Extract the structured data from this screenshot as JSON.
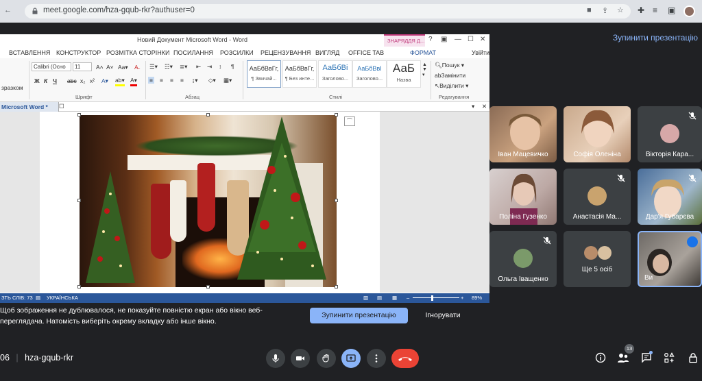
{
  "browser": {
    "url": "meet.google.com/hza-gqub-rkr?authuser=0"
  },
  "meet": {
    "stop_presenting_link": "Зупинити презентацію",
    "meeting_code": "hza-gqub-rkr",
    "time_fragment": "06",
    "participants_count": "13",
    "tiles": [
      {
        "name": "Іван Мацевичко",
        "muted": false
      },
      {
        "name": "Софія Оленіна",
        "muted": false
      },
      {
        "name": "Вікторія Кара...",
        "muted": true
      },
      {
        "name": "Поліна Гузенко",
        "muted": false
      },
      {
        "name": "Анастасія Ма...",
        "muted": true
      },
      {
        "name": "Дар'я Губарєва",
        "muted": true
      },
      {
        "name": "Ольга Іващенко",
        "muted": true
      },
      {
        "name": "Ще 5 осіб",
        "muted": false
      },
      {
        "name": "Ви",
        "muted": false
      }
    ],
    "warning_line1": "Щоб зображення не дублювалося, не показуйте повністю екран або вікно веб-",
    "warning_line2": "переглядача. Натомість виберіть окрему вкладку або інше вікно.",
    "stop_button": "Зупинити презентацію",
    "ignore_button": "Ігнорувати"
  },
  "word": {
    "title": "Новий Документ Microsoft Word - Word",
    "context_tab": "ЗНАРЯДДЯ Д...",
    "format_tab": "ФОРМАТ",
    "sign_in": "Увійти",
    "tabs": [
      "ВСТАВЛЕННЯ",
      "КОНСТРУКТОР",
      "РОЗМІТКА СТОРІНКИ",
      "ПОСИЛАННЯ",
      "РОЗСИЛКИ",
      "РЕЦЕНЗУВАННЯ",
      "ВИГЛЯД",
      "OFFICE TAB"
    ],
    "clipboard_label": "зразком",
    "font_name": "Calibri (Осно",
    "font_size": "11",
    "bold": "Ж",
    "italic": "К",
    "underline": "Ч",
    "strike": "abc",
    "subscript": "x₂",
    "superscript": "x²",
    "group_font": "Шрифт",
    "group_paragraph": "Абзац",
    "group_styles": "Стилі",
    "group_editing": "Редагування",
    "styles": [
      {
        "preview": "АаБбВвГг,",
        "name": "¶ Звичай..."
      },
      {
        "preview": "АаБбВвГг,",
        "name": "¶ Без инте..."
      },
      {
        "preview": "АаБбВі",
        "name": "Заголово..."
      },
      {
        "preview": "АаБбВвІ",
        "name": "Заголово..."
      },
      {
        "preview": "АаБ",
        "name": "Назва"
      }
    ],
    "find": "Пошук",
    "replace": "Замінити",
    "select": "Виділити",
    "doc_tab": "Microsoft Word *",
    "status_words": "ЛОВА: 73",
    "status_words_left": "ЗТЬ СЛІВ: 73",
    "status_lang": "УКРАЇНСЬКА",
    "zoom": "89%"
  },
  "colors": {
    "word_blue": "#2b579a",
    "meet_bg": "#202124",
    "tile_bg": "#3c4043",
    "end_call_red": "#ea4335",
    "present_blue": "#8ab4f8"
  }
}
